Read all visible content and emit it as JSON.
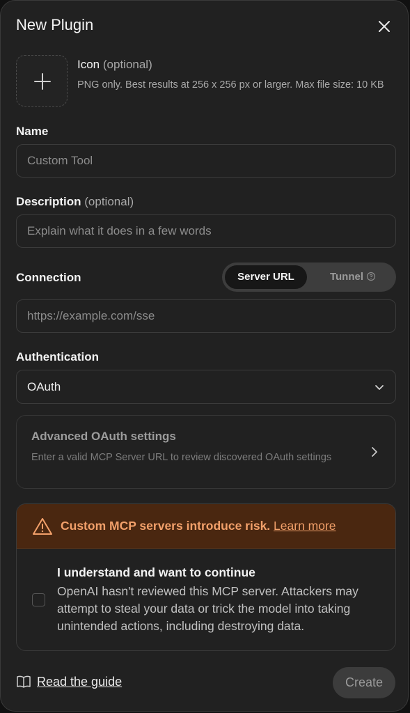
{
  "dialog": {
    "title": "New Plugin"
  },
  "icon_upload": {
    "title": "Icon",
    "optional": "(optional)",
    "hint": "PNG only. Best results at 256 x 256 px or larger. Max file size: 10 KB"
  },
  "name": {
    "label": "Name",
    "placeholder": "Custom Tool",
    "value": ""
  },
  "description": {
    "label": "Description",
    "optional": "(optional)",
    "placeholder": "Explain what it does in a few words",
    "value": ""
  },
  "connection": {
    "label": "Connection",
    "options": [
      "Server URL",
      "Tunnel"
    ],
    "selected": "Server URL",
    "url_placeholder": "https://example.com/sse",
    "url_value": ""
  },
  "authentication": {
    "label": "Authentication",
    "selected": "OAuth"
  },
  "advanced": {
    "title": "Advanced OAuth settings",
    "description": "Enter a valid MCP Server URL to review discovered OAuth settings"
  },
  "risk": {
    "warning": "Custom MCP servers introduce risk.",
    "link": "Learn more",
    "ack_title": "I understand and want to continue",
    "ack_body": "OpenAI hasn't reviewed this MCP server. Attackers may attempt to steal your data or trick the model into taking unintended actions, including destroying data.",
    "checked": false
  },
  "footer": {
    "guide_link": "Read the guide",
    "create_label": "Create"
  },
  "colors": {
    "background": "#212121",
    "warning_bg": "#4a2710",
    "warning_text": "#f2a06a"
  }
}
